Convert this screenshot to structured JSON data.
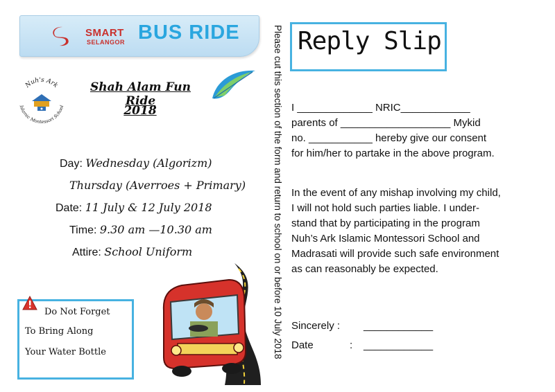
{
  "flyer": {
    "brand_line1": "SMART",
    "brand_line2": "SELANGOR",
    "banner_title": "BUS RIDE",
    "school_logo": {
      "icon": "school-crest-logo",
      "ring_text_top": "Nuh's Ark",
      "ring_text_bottom": "Islamic Montessori School"
    },
    "event_title": "Shah Alam Fun Ride",
    "event_year": "2018",
    "details": {
      "day_label": "Day: ",
      "day_value": "Wednesday (Algorizm)",
      "day_value2": "Thursday (Averroes + Primary)",
      "date_label": "Date: ",
      "date_value": "11 July & 12 July 2018",
      "time_label": "Time: ",
      "time_value": "9.30 am —10.30 am",
      "attire_label": "Attire: ",
      "attire_value": "School Uniform"
    },
    "reminder": {
      "icon": "warning-icon",
      "line1": "Do Not Forget",
      "line2": "To Bring Along",
      "line3": "Your Water Bottle"
    },
    "illustration": "bus-on-road-illustration"
  },
  "cut_note": "Please cut  this section of the form and return to school on or before 10 July 2018",
  "reply_slip": {
    "title": "Reply Slip",
    "p1": [
      "I _____________ NRIC____________",
      "parents of ___________________ Mykid",
      "no. ___________ hereby give our consent",
      "for him/her to partake in the above program."
    ],
    "p2": [
      "In the event of any mishap involving my child,",
      "I will not hold such parties liable. I under-",
      "stand that by participating in the program",
      "Nuh’s Ark Islamic Montessori School and",
      "Madrasati will provide such safe environment",
      "as can reasonably be expected."
    ],
    "sincerely_label": "Sincerely :",
    "sincerely_line": "____________",
    "date_label": "Date",
    "date_colon": ":",
    "date_line": "____________"
  },
  "colors": {
    "accent_blue": "#47b2e1",
    "banner_text": "#2aa6df",
    "brand_red": "#c9302c",
    "bus_red": "#d6322b"
  }
}
